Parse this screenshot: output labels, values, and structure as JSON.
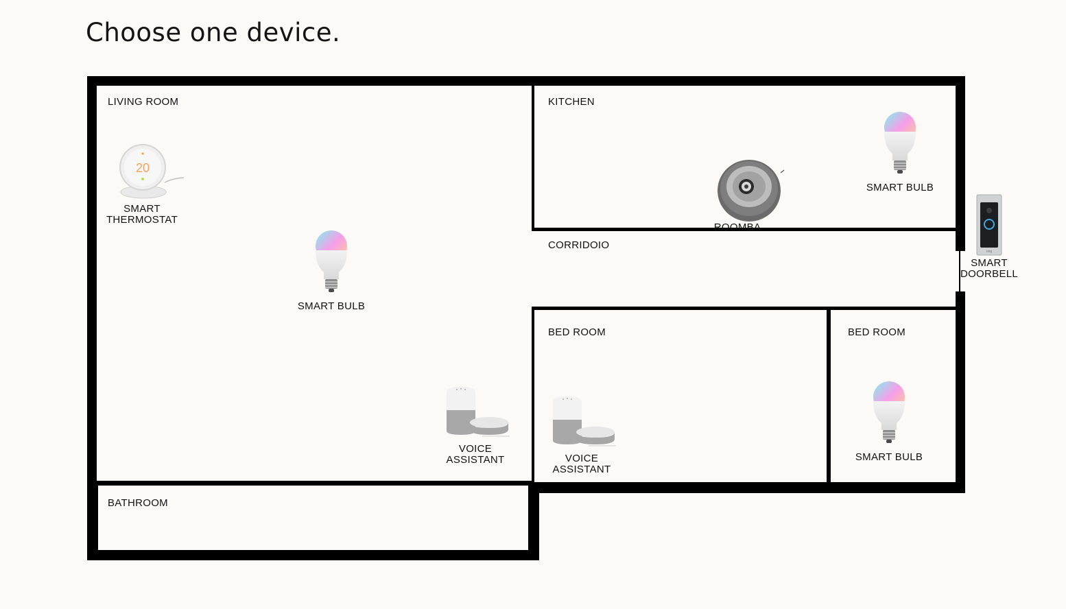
{
  "page": {
    "title": "Choose one device."
  },
  "rooms": {
    "living_room": "LIVING ROOM",
    "kitchen": "KITCHEN",
    "corridor": "CORRIDOIO",
    "bed_room_1": "BED ROOM",
    "bed_room_2": "BED ROOM",
    "bathroom": "BATHROOM"
  },
  "devices": {
    "thermostat": {
      "label": "SMART\nTHERMOSTAT",
      "icon": "thermostat-icon",
      "reading": "20"
    },
    "bulb_living": {
      "label": "SMART BULB",
      "icon": "smart-bulb-icon"
    },
    "voice_living": {
      "label": "VOICE\nASSISTANT",
      "icon": "voice-assistant-icon"
    },
    "roomba": {
      "label": "ROOMBA",
      "icon": "robot-vacuum-icon"
    },
    "bulb_kitchen": {
      "label": "SMART BULB",
      "icon": "smart-bulb-icon"
    },
    "doorbell": {
      "label": "SMART\nDOORBELL",
      "icon": "doorbell-icon"
    },
    "voice_bedroom": {
      "label": "VOICE\nASSISTANT",
      "icon": "voice-assistant-icon"
    },
    "bulb_bedroom": {
      "label": "SMART BULB",
      "icon": "smart-bulb-icon"
    }
  },
  "colors": {
    "background": "#fbfaf6",
    "wall": "#000000"
  }
}
